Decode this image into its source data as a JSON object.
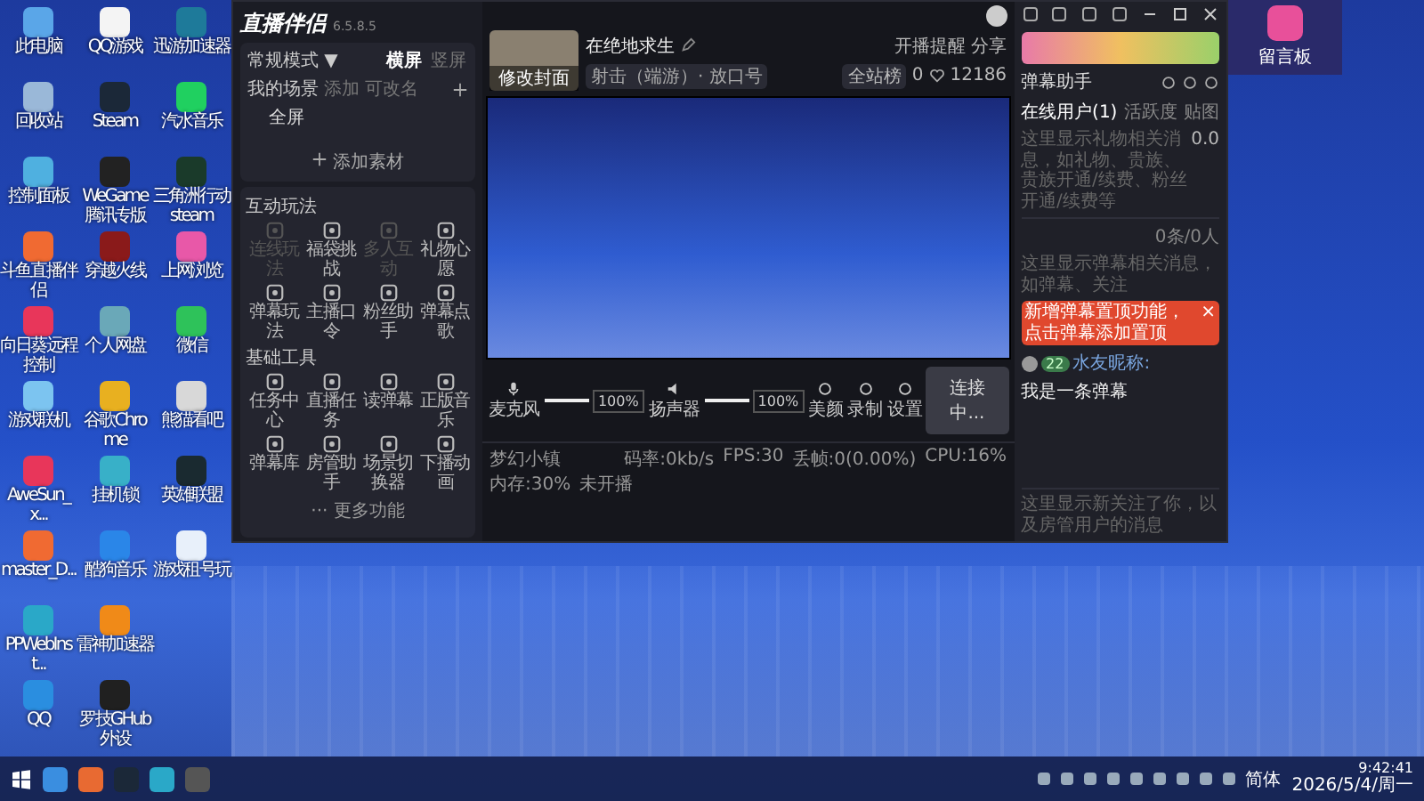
{
  "desktop": {
    "icons": [
      {
        "label": "此电脑",
        "color": "#5aa6e8"
      },
      {
        "label": "回收站",
        "color": "#9ab8d8"
      },
      {
        "label": "控制面板",
        "color": "#4fb0e0"
      },
      {
        "label": "斗鱼直播伴侣",
        "color": "#f06a32"
      },
      {
        "label": "向日葵远程控制",
        "color": "#e8365a"
      },
      {
        "label": "游戏联机",
        "color": "#7cc4f0"
      },
      {
        "label": "AweSun_x...",
        "color": "#e8365a"
      },
      {
        "label": "master_D...",
        "color": "#f06a32"
      },
      {
        "label": "PPWebInst...",
        "color": "#2aa8c8"
      },
      {
        "label": "QQ",
        "color": "#2a8ee0"
      },
      {
        "label": "QQ游戏",
        "color": "#f4f4f4"
      },
      {
        "label": "Steam",
        "color": "#1b2838"
      },
      {
        "label": "WeGame腾讯专版",
        "color": "#222222"
      },
      {
        "label": "穿越火线",
        "color": "#8a1a1a"
      },
      {
        "label": "个人网盘",
        "color": "#6aa8b8"
      },
      {
        "label": "谷歌Chrome",
        "color": "#e8b020"
      },
      {
        "label": "挂机锁",
        "color": "#38b0c8"
      },
      {
        "label": "酷狗音乐",
        "color": "#2a86e8"
      },
      {
        "label": "雷神加速器",
        "color": "#f08a18"
      },
      {
        "label": "罗技GHub外设",
        "color": "#202020"
      },
      {
        "label": "迅游加速器",
        "color": "#1e7a9a"
      },
      {
        "label": "汽水音乐",
        "color": "#20d060"
      },
      {
        "label": "三角洲行动steam",
        "color": "#1a3a2a"
      },
      {
        "label": "上网浏览",
        "color": "#e858a8"
      },
      {
        "label": "微信",
        "color": "#2ec25a"
      },
      {
        "label": "熊猫看吧",
        "color": "#d8d8d8"
      },
      {
        "label": "英雄联盟",
        "color": "#1a2a30"
      },
      {
        "label": "游戏租号玩",
        "color": "#e8f0fa"
      }
    ]
  },
  "app": {
    "logo": "直播伴侣",
    "version": "6.5.8.5",
    "mode": "常规模式",
    "mode_caret": "▼",
    "orientation_tabs": [
      {
        "label": "横屏",
        "selected": true
      },
      {
        "label": "竖屏",
        "selected": false
      }
    ],
    "scenes": {
      "title": "我的场景",
      "actions": [
        "添加",
        "可改名"
      ],
      "items": [
        {
          "label": "全屏"
        }
      ]
    },
    "add_material": "添加素材",
    "interactive": {
      "title": "互动玩法",
      "items": [
        {
          "label": "连线玩法",
          "disabled": true
        },
        {
          "label": "福袋挑战",
          "disabled": false
        },
        {
          "label": "多人互动",
          "disabled": true
        },
        {
          "label": "礼物心愿",
          "disabled": false
        },
        {
          "label": "弹幕玩法",
          "disabled": false
        },
        {
          "label": "主播口令",
          "disabled": false
        },
        {
          "label": "粉丝助手",
          "disabled": false
        },
        {
          "label": "弹幕点歌",
          "disabled": false
        }
      ]
    },
    "tools": {
      "title": "基础工具",
      "items": [
        {
          "label": "任务中心",
          "disabled": false
        },
        {
          "label": "直播任务",
          "disabled": false
        },
        {
          "label": "读弹幕",
          "disabled": false
        },
        {
          "label": "正版音乐",
          "disabled": false
        },
        {
          "label": "弹幕库",
          "disabled": false
        },
        {
          "label": "房管助手",
          "disabled": false
        },
        {
          "label": "场景切换器",
          "disabled": false
        },
        {
          "label": "下播动画",
          "disabled": false
        }
      ]
    },
    "more": "··· 更多功能",
    "stream": {
      "cover_label": "修改封面",
      "title": "在绝地求生",
      "category": "射击（端游）· 放口号",
      "remind": "开播提醒",
      "share": "分享",
      "rank": "全站榜",
      "likes": "0",
      "hearts": "12186"
    },
    "controls": {
      "channels": [
        {
          "name": "麦克风",
          "level": 1,
          "reading": "100%"
        },
        {
          "name": "扬声器",
          "level": 1,
          "reading": "100%"
        }
      ],
      "actions": [
        "美颜",
        "录制",
        "设置"
      ],
      "connect": "连接中..."
    },
    "status_bar": {
      "scene": "梦幻小镇",
      "items": [
        "码率:0kb/s",
        "FPS:30",
        "丢帧:0(0.00%)",
        "CPU:16%",
        "内存:30%",
        "未开播"
      ]
    },
    "danmu": {
      "title": "弹幕助手",
      "tabs": [
        {
          "label": "在线用户(1)",
          "selected": true
        },
        {
          "label": "活跃度",
          "selected": false
        },
        {
          "label": "贴图",
          "selected": false
        }
      ],
      "gift_hint": "这里显示礼物相关消息，如礼物、贵族、贵族开通/续费、粉丝开通/续费等",
      "gift_value": "0.0",
      "chat_hint": "这里显示弹幕相关消息，如弹幕、关注",
      "chat_count": "0条/0人",
      "tip": "新增弹幕置顶功能，点击弹幕添加置顶",
      "tip_close": "×",
      "message": {
        "fan_level": "22",
        "name": "水友昵称:",
        "text": "我是一条弹幕"
      },
      "follow_hint": "这里显示新关注了你，以及房管用户的消息"
    }
  },
  "side_widget": {
    "label": "留言板"
  },
  "taskbar": {
    "ime": "简体",
    "time": "9:42:41",
    "date": "2026/5/4/周一"
  }
}
